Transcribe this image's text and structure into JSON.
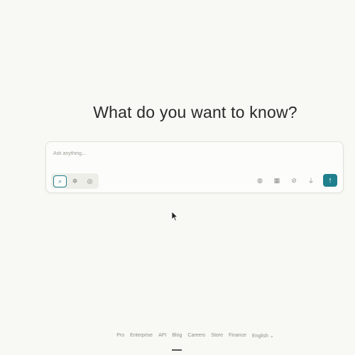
{
  "main": {
    "headline": "What do you want to know?"
  },
  "search": {
    "placeholder": "Ask anything...",
    "value": ""
  },
  "modes": [
    {
      "icon": "search-icon",
      "glyph": "⌕",
      "active": true
    },
    {
      "icon": "reasoning-icon",
      "glyph": "✲",
      "active": false
    },
    {
      "icon": "research-icon",
      "glyph": "◎",
      "active": false
    }
  ],
  "tools": [
    {
      "icon": "globe-icon",
      "glyph": "◍"
    },
    {
      "icon": "grid-icon",
      "glyph": "▦"
    },
    {
      "icon": "attach-icon",
      "glyph": "⊘"
    },
    {
      "icon": "mic-icon",
      "glyph": "⏚"
    }
  ],
  "submit": {
    "glyph": "↑"
  },
  "footer": {
    "links": [
      "Pro",
      "Enterprise",
      "API",
      "Blog",
      "Careers",
      "Store",
      "Finance",
      "English ⌄"
    ],
    "current_index": 3
  },
  "colors": {
    "accent": "#20808d",
    "background": "#f8f8f4",
    "text": "#2a2a2a"
  }
}
